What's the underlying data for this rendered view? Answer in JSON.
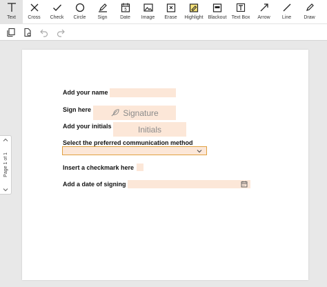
{
  "toolbar": {
    "tools": [
      {
        "label": "Text",
        "icon": "text-icon"
      },
      {
        "label": "Cross",
        "icon": "cross-icon"
      },
      {
        "label": "Check",
        "icon": "check-icon"
      },
      {
        "label": "Circle",
        "icon": "circle-icon"
      },
      {
        "label": "Sign",
        "icon": "pen-icon"
      },
      {
        "label": "Date",
        "icon": "calendar-icon"
      },
      {
        "label": "Image",
        "icon": "image-icon"
      },
      {
        "label": "Erase",
        "icon": "eraser-icon"
      },
      {
        "label": "Highlight",
        "icon": "highlighter-icon"
      },
      {
        "label": "Blackout",
        "icon": "blackout-icon"
      },
      {
        "label": "Text Box",
        "icon": "textbox-icon"
      },
      {
        "label": "Arrow",
        "icon": "arrow-icon"
      },
      {
        "label": "Line",
        "icon": "line-icon"
      },
      {
        "label": "Draw",
        "icon": "draw-icon"
      }
    ]
  },
  "subbar": {
    "icons": [
      "pages-icon",
      "page-settings-icon",
      "undo-icon",
      "redo-icon"
    ]
  },
  "page_nav": {
    "label": "Page 1 of 1"
  },
  "form": {
    "name_label": "Add your name",
    "sign_label": "Sign here",
    "signature_placeholder": "Signature",
    "initials_label": "Add your initials",
    "initials_placeholder": "Initials",
    "communication_label": "Select the preferred communication method",
    "communication_value": "",
    "checkmark_label": "Insert a checkmark here",
    "date_label": "Add a date of signing"
  },
  "colors": {
    "field_fill": "#fce7d8",
    "selected_border": "#e0a040",
    "tool_selected": "#e4e4e4"
  }
}
